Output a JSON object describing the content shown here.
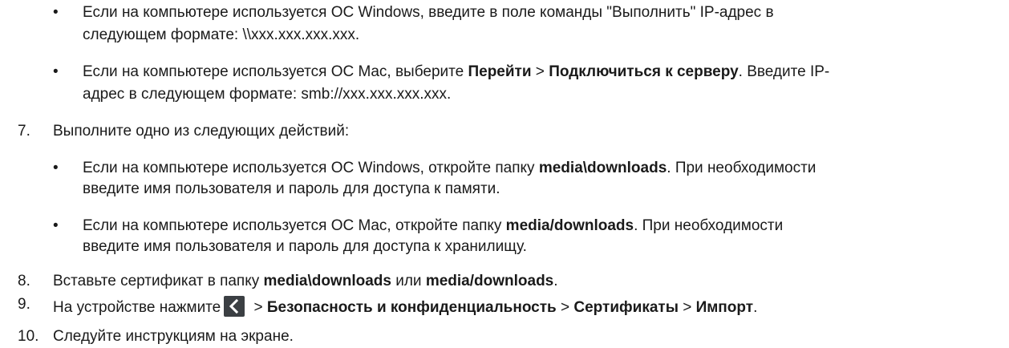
{
  "bullets_top": [
    {
      "line1": "Если на компьютере используется ОС Windows, введите в поле команды \"Выполнить\" IP-адрес в",
      "line2": "следующем формате: \\\\xxx.xxx.xxx.xxx."
    },
    {
      "line1_pre": "Если на компьютере используется ОС Mac, выберите ",
      "line1_b1": "Перейти",
      "line1_mid": " > ",
      "line1_b2": "Подключиться к серверу",
      "line1_post": ". Введите IP-",
      "line2": "адрес в следующем формате: smb://xxx.xxx.xxx.xxx."
    }
  ],
  "step7": {
    "number": "7.",
    "text": "Выполните одно из следующих действий:",
    "bullets": [
      {
        "line1_pre": "Если на компьютере используется ОС Windows, откройте папку ",
        "line1_b": "media\\downloads",
        "line1_post": ". При необходимости",
        "line2": "введите имя пользователя и пароль для доступа к памяти."
      },
      {
        "line1_pre": "Если на компьютере используется ОС Mac, откройте папку ",
        "line1_b": "media/downloads",
        "line1_post": ". При необходимости",
        "line2": "введите имя пользователя и пароль для доступа к хранилищу."
      }
    ]
  },
  "step8": {
    "number": "8.",
    "pre": "Вставьте сертификат в папку ",
    "b1": "media\\downloads",
    "mid": " или ",
    "b2": "media/downloads",
    "post": "."
  },
  "step9": {
    "number": "9.",
    "pre": "На устройстве нажмите",
    "icon": "back-chevron-icon",
    "gt1": " > ",
    "b1": "Безопасность и конфиденциальность",
    "gt2": " > ",
    "b2": "Сертификаты",
    "gt3": " > ",
    "b3": "Импорт",
    "post": "."
  },
  "step10": {
    "number": "10.",
    "text": "Следуйте инструкциям на экране."
  },
  "bullet_char": "•"
}
